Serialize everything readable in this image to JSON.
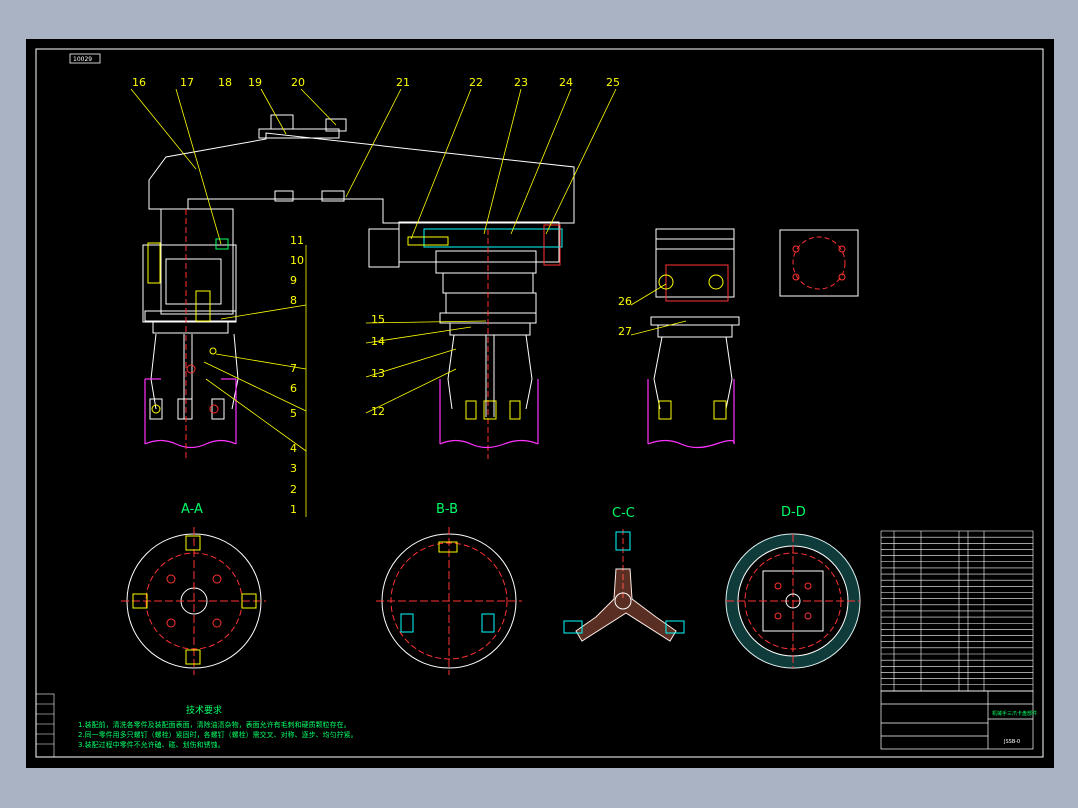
{
  "drawing": {
    "corner_tag": "10029",
    "section_labels": [
      "A-A",
      "B-B",
      "C-C",
      "D-D"
    ],
    "part_numbers_left_column": [
      "11",
      "10",
      "9",
      "8",
      "7",
      "6",
      "5",
      "4",
      "3",
      "2",
      "1"
    ],
    "part_numbers_top": [
      "16",
      "17",
      "18",
      "19",
      "20",
      "21",
      "22",
      "23",
      "24",
      "25"
    ],
    "part_numbers_middle": [
      "15",
      "14",
      "13",
      "12"
    ],
    "part_numbers_right": [
      "26",
      "27"
    ],
    "tech_requirements": {
      "title": "技术要求",
      "lines": [
        "1.装配前，清洗各零件及装配面表面，清除油渍杂物，表面允许有毛刺和硬质颗粒存在。",
        "2.同一零件用多只螺钉（螺栓）紧固时，各螺钉（螺栓）需交叉、对称、逐步、均匀拧紧。",
        "3.装配过程中零件不允许磕、碰、划伤和锈蚀。"
      ]
    },
    "title_block": {
      "drawing_name": "机械手三爪卡盘部件",
      "drawing_code": "JSSB-0"
    }
  }
}
